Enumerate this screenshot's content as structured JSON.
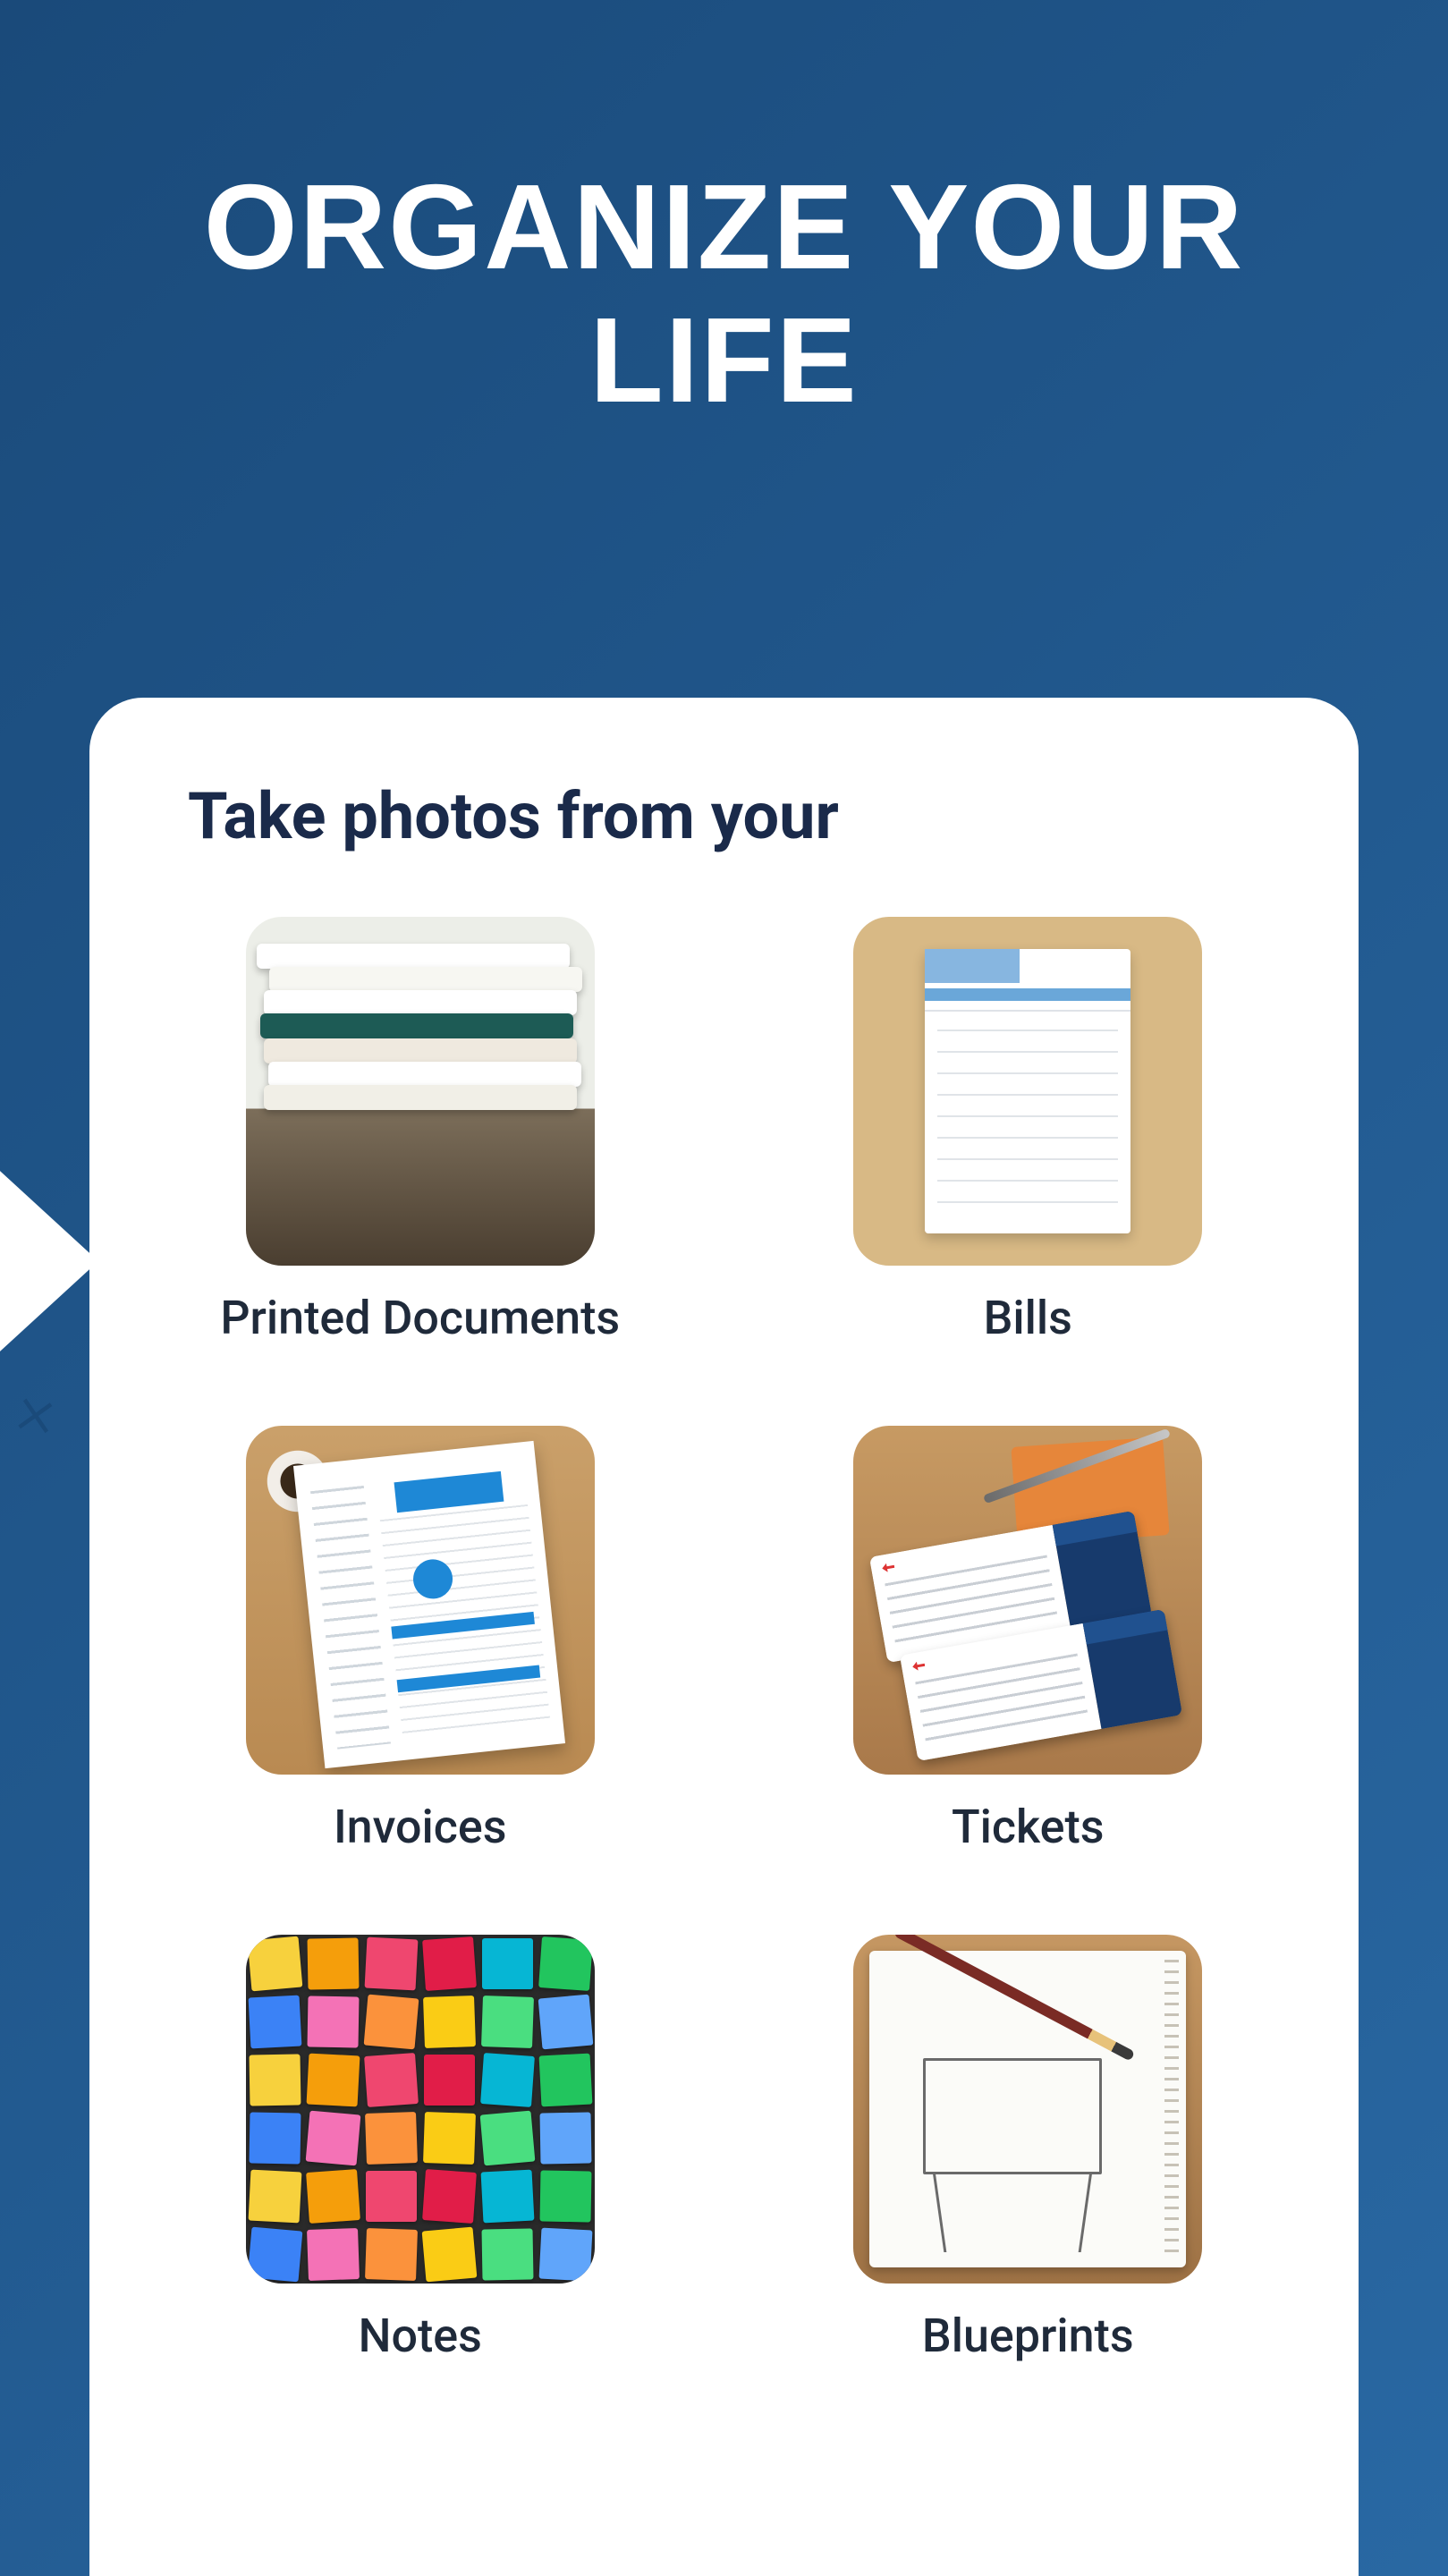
{
  "headline": "ORGANIZE YOUR LIFE",
  "subtitle": "Take photos from your",
  "items": [
    {
      "label": "Printed Documents",
      "icon": "stacked-papers"
    },
    {
      "label": "Bills",
      "icon": "bill-sheet"
    },
    {
      "label": "Invoices",
      "icon": "invoice-page"
    },
    {
      "label": "Tickets",
      "icon": "boarding-pass"
    },
    {
      "label": "Notes",
      "icon": "sticky-notes"
    },
    {
      "label": "Blueprints",
      "icon": "sketchbook"
    }
  ]
}
